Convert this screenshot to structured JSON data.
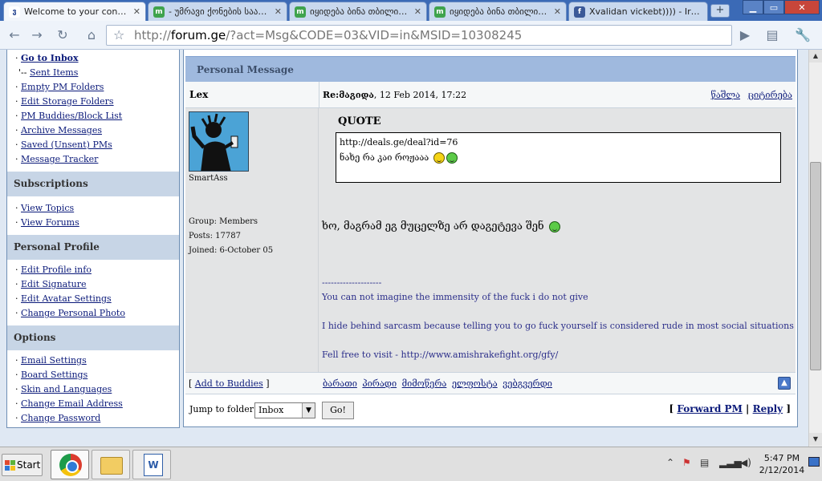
{
  "browser": {
    "tabs": [
      {
        "title": "Welcome to your contr…",
        "favicon": "forum-g-icon",
        "active": true
      },
      {
        "title": "- უმრავი ქონების საავ‌ტო…",
        "favicon": "site-globe-icon",
        "active": false
      },
      {
        "title": "იყიდება ბინა თბილისში",
        "favicon": "site-globe-icon",
        "active": false
      },
      {
        "title": "იყიდება ბინა თბილისში",
        "favicon": "site-globe-icon",
        "active": false
      },
      {
        "title": "Xvalidan vickebt)))) - Ir…",
        "favicon": "facebook-icon",
        "active": false
      }
    ],
    "new_tab": "+",
    "url_prefix": "http://",
    "url_host": "forum.ge",
    "url_rest": "/?act=Msg&CODE=03&VID=in&MSID=10308245"
  },
  "sidebar": {
    "top_links": [
      {
        "prefix": "· ",
        "label": "Go to Inbox",
        "bold": true
      },
      {
        "prefix": "'-- ",
        "label": "Sent Items",
        "bold": false
      },
      {
        "prefix": "· ",
        "label": "Empty PM Folders",
        "bold": false
      },
      {
        "prefix": "· ",
        "label": "Edit Storage Folders",
        "bold": false
      },
      {
        "prefix": "· ",
        "label": "PM Buddies/Block List",
        "bold": false
      },
      {
        "prefix": "· ",
        "label": "Archive Messages",
        "bold": false
      },
      {
        "prefix": "· ",
        "label": "Saved (Unsent) PMs",
        "bold": false
      },
      {
        "prefix": "· ",
        "label": "Message Tracker",
        "bold": false
      }
    ],
    "subscriptions_header": "Subscriptions",
    "subscriptions": [
      "View Topics",
      "View Forums"
    ],
    "profile_header": "Personal Profile",
    "profile_links": [
      "Edit Profile info",
      "Edit Signature",
      "Edit Avatar Settings",
      "Change Personal Photo"
    ],
    "options_header": "Options",
    "options_links": [
      "Email Settings",
      "Board Settings",
      "Skin and Languages",
      "Change Email Address",
      "Change Password"
    ]
  },
  "message": {
    "header": "Personal Message",
    "author": "Lex",
    "subject_prefix": "Re:",
    "subject": "მაგიდა",
    "date": ", 12 Feb 2014, 17:22",
    "actions": [
      "წაშლა",
      "ციტირება"
    ],
    "user_title": "SmartAss",
    "group": "Group: Members",
    "posts": "Posts: 17787",
    "joined": "Joined: 6-October 05",
    "quote_title": "QUOTE",
    "quote_line1": "http://deals.ge/deal?id=76",
    "quote_line2": "ნახე რა კაი როჟააა",
    "reply": "ხო, მაგრამ ეგ მუცელზე არ დაგეტევა შენ",
    "sig_divider": "--------------------",
    "sig_line1": "You can not imagine the immensity of the fuck i do not give",
    "sig_line2": "I hide behind sarcasm because telling you to go fuck yourself is considered rude in most social situations",
    "sig_line3": "Fell free to visit - http://www.amishrakefight.org/gfy/",
    "add_buddies": "Add to Buddies",
    "user_links": [
      "ბარათი",
      "პირადი",
      "მიმოწერა",
      "ელფოსტა",
      "ვებგვერდი"
    ],
    "jump_label": "Jump to folder:",
    "folder_value": "Inbox",
    "go_label": "Go!",
    "forward_label": "Forward PM",
    "reply_label": "Reply"
  },
  "taskbar": {
    "start_label": "Start",
    "time": "5:47 PM",
    "date": "2/12/2014"
  }
}
